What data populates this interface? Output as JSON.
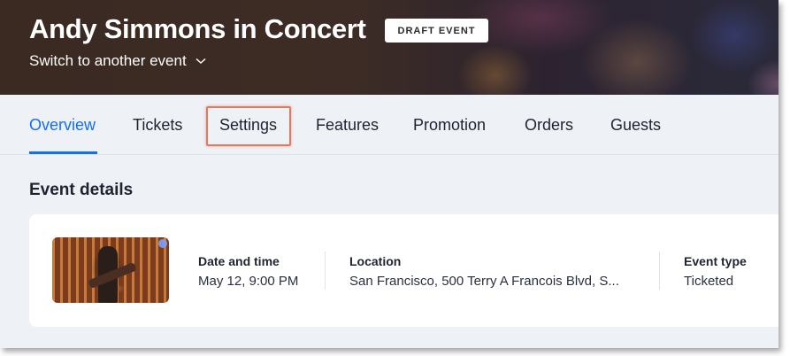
{
  "header": {
    "event_title": "Andy Simmons in Concert",
    "status_badge": "DRAFT EVENT",
    "switch_event_label": "Switch to another event"
  },
  "tabs": [
    {
      "label": "Overview",
      "active": true
    },
    {
      "label": "Tickets",
      "active": false
    },
    {
      "label": "Settings",
      "active": false,
      "highlighted": true
    },
    {
      "label": "Features",
      "active": false
    },
    {
      "label": "Promotion",
      "active": false
    },
    {
      "label": "Orders",
      "active": false
    },
    {
      "label": "Guests",
      "active": false
    }
  ],
  "event_details": {
    "section_title": "Event details",
    "date_time": {
      "label": "Date and time",
      "value": "May 12, 9:00 PM"
    },
    "location": {
      "label": "Location",
      "value": "San Francisco, 500 Terry A Francois Blvd, S..."
    },
    "event_type": {
      "label": "Event type",
      "value": "Ticketed"
    }
  },
  "colors": {
    "accent": "#116dff",
    "highlight": "#e07a5f",
    "background": "#eef1f6"
  },
  "icons": {
    "switch_event": "chevron-down-icon",
    "thumbnail": "event-image"
  }
}
